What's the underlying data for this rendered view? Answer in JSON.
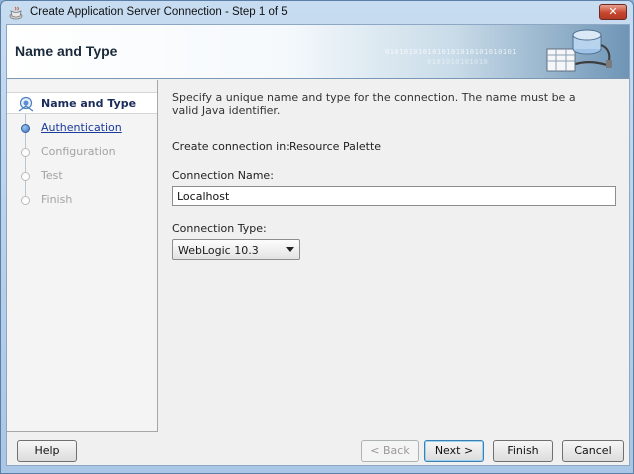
{
  "window": {
    "title": "Create Application Server Connection - Step 1 of 5",
    "close_label": "✕"
  },
  "banner": {
    "title": "Name and Type",
    "binary_line1": "0101010101010101010101010101",
    "binary_line2": "0101010101010"
  },
  "nav": {
    "items": [
      {
        "label": "Name and Type",
        "state": "active"
      },
      {
        "label": "Authentication",
        "state": "link"
      },
      {
        "label": "Configuration",
        "state": "disabled"
      },
      {
        "label": "Test",
        "state": "disabled"
      },
      {
        "label": "Finish",
        "state": "disabled"
      }
    ]
  },
  "main": {
    "description": "Specify a unique name and type for the connection. The name must be a valid Java identifier.",
    "create_in_label": "Create connection in:",
    "create_in_value": "Resource Palette",
    "connection_name_label": "Connection Name:",
    "connection_name_value": "Localhost",
    "connection_type_label": "Connection Type:",
    "connection_type_value": "WebLogic 10.3"
  },
  "buttons": {
    "help": "Help",
    "back": "< Back",
    "next": "Next >",
    "finish": "Finish",
    "cancel": "Cancel"
  },
  "colors": {
    "link": "#1b3a9a",
    "active_nav_text": "#1c2c5a",
    "close_button": "#c7462f",
    "banner_gradient_end": "#6f95b6"
  }
}
